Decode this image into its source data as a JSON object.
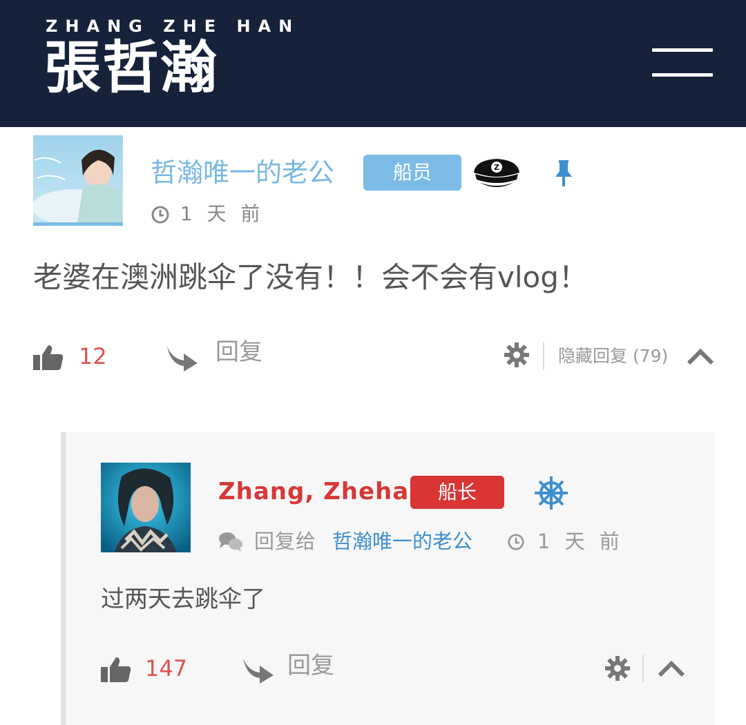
{
  "header": {
    "subtitle": "ZHANG ZHE HAN",
    "logo": "張哲瀚",
    "menu_icon": "hamburger-menu-icon",
    "background": "#16213a"
  },
  "comment": {
    "username": "哲瀚唯一的老公",
    "badge": "船员",
    "badge_color": "#7bbbe6",
    "rank_icon": "captain-hat-icon",
    "pin_icon": "pin-icon",
    "time": "1 天 前",
    "body": "老婆在澳洲跳伞了没有！！会不会有vlog！",
    "likes": "12",
    "reply_label": "回复",
    "hide_replies_label": "隐藏回复 (79)"
  },
  "reply": {
    "username": "Zhang, Zhehan",
    "badge": "船长",
    "badge_color": "#d93535",
    "rank_icon": "ship-wheel-icon",
    "reply_to_label": "回复给",
    "reply_to_user": "哲瀚唯一的老公",
    "time": "1 天 前",
    "body": "过两天去跳伞了",
    "likes": "147",
    "reply_label": "回复"
  }
}
